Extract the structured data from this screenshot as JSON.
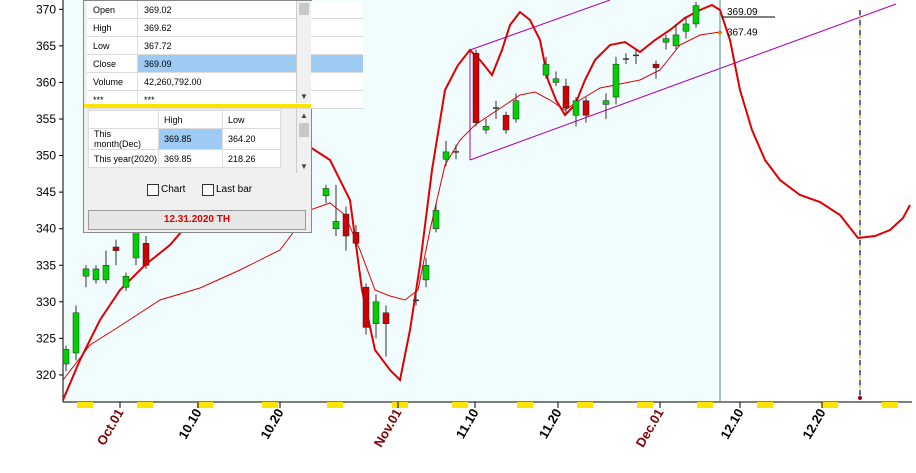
{
  "chart_data": {
    "type": "candlestick",
    "y_ticks": [
      370,
      365,
      360,
      355,
      350,
      345,
      340,
      335,
      330,
      325,
      320
    ],
    "ylim": [
      316.3,
      371
    ],
    "x_ticks": [
      {
        "label": "Oct.01",
        "highlight": true
      },
      {
        "label": "10.10",
        "highlight": false
      },
      {
        "label": "10.20",
        "highlight": false
      },
      {
        "label": "Nov.01",
        "highlight": true
      },
      {
        "label": "11.10",
        "highlight": false
      },
      {
        "label": "11.20",
        "highlight": false
      },
      {
        "label": "Dec.01",
        "highlight": true
      },
      {
        "label": "12.10",
        "highlight": false
      },
      {
        "label": "12.20",
        "highlight": false
      }
    ],
    "candles": [
      {
        "x": 1,
        "open": 321.5,
        "close": 323.5,
        "high": 324,
        "low": 320.5
      },
      {
        "x": 2,
        "open": 323,
        "close": 328.5,
        "high": 329.5,
        "low": 322
      },
      {
        "x": 3,
        "open": 333.5,
        "close": 334.5,
        "high": 335,
        "low": 332
      },
      {
        "x": 4,
        "open": 333,
        "close": 334.5,
        "high": 335,
        "low": 332.5
      },
      {
        "x": 5,
        "open": 333,
        "close": 335,
        "high": 337,
        "low": 332.5
      },
      {
        "x": 6,
        "open": 337.5,
        "close": 337,
        "high": 338.5,
        "low": 335
      },
      {
        "x": 7,
        "open": 332,
        "close": 333.5,
        "high": 334,
        "low": 331.5
      },
      {
        "x": 8,
        "open": 336,
        "close": 340,
        "high": 341,
        "low": 335
      },
      {
        "x": 9,
        "open": 338,
        "close": 335,
        "high": 339,
        "low": 334.5
      },
      {
        "x": 27,
        "open": 344.5,
        "close": 345.5,
        "high": 346,
        "low": 343.5
      },
      {
        "x": 28,
        "open": 340,
        "close": 341,
        "high": 346,
        "low": 339
      },
      {
        "x": 29,
        "open": 342,
        "close": 339,
        "high": 343,
        "low": 337
      },
      {
        "x": 30,
        "open": 339.5,
        "close": 338,
        "high": 340.5,
        "low": 337.5
      },
      {
        "x": 31,
        "open": 332,
        "close": 326.5,
        "high": 332.5,
        "low": 325.5
      },
      {
        "x": 32,
        "open": 327,
        "close": 330,
        "high": 331,
        "low": 325
      },
      {
        "x": 33,
        "open": 328.5,
        "close": 327,
        "high": 329.5,
        "low": 322.5
      },
      {
        "x": 36,
        "open": 330,
        "close": 330.2,
        "high": 331.5,
        "low": 329.5
      },
      {
        "x": 37,
        "open": 333,
        "close": 335,
        "high": 336,
        "low": 332
      },
      {
        "x": 38,
        "open": 340,
        "close": 342.5,
        "high": 343.5,
        "low": 339.5
      },
      {
        "x": 39,
        "open": 349.5,
        "close": 350.5,
        "high": 352,
        "low": 348.5
      },
      {
        "x": 40,
        "open": 350.5,
        "close": 350.5,
        "high": 351.5,
        "low": 349.5
      },
      {
        "x": 42,
        "open": 364,
        "close": 354.5,
        "high": 364.5,
        "low": 354
      },
      {
        "x": 43,
        "open": 353.5,
        "close": 354,
        "high": 355,
        "low": 353
      },
      {
        "x": 44,
        "open": 356.5,
        "close": 356.5,
        "high": 357.5,
        "low": 355
      },
      {
        "x": 45,
        "open": 355.5,
        "close": 353.5,
        "high": 356,
        "low": 353
      },
      {
        "x": 46,
        "open": 355,
        "close": 357.5,
        "high": 358.5,
        "low": 354.5
      },
      {
        "x": 49,
        "open": 361,
        "close": 362.5,
        "high": 363.5,
        "low": 360.5
      },
      {
        "x": 50,
        "open": 360,
        "close": 360.5,
        "high": 361.5,
        "low": 359.5
      },
      {
        "x": 51,
        "open": 359.5,
        "close": 356.5,
        "high": 360.5,
        "low": 355.5
      },
      {
        "x": 52,
        "open": 355.5,
        "close": 357.5,
        "high": 358,
        "low": 354
      },
      {
        "x": 53,
        "open": 357.5,
        "close": 355.5,
        "high": 358,
        "low": 354.5
      },
      {
        "x": 55,
        "open": 357,
        "close": 357.5,
        "high": 358.5,
        "low": 355
      },
      {
        "x": 56,
        "open": 358,
        "close": 362.5,
        "high": 363.5,
        "low": 357
      },
      {
        "x": 57,
        "open": 363,
        "close": 363.2,
        "high": 364,
        "low": 362.5
      },
      {
        "x": 58,
        "open": 363.5,
        "close": 363.7,
        "high": 364.5,
        "low": 362.5
      },
      {
        "x": 60,
        "open": 362.5,
        "close": 362,
        "high": 363,
        "low": 360.5
      },
      {
        "x": 61,
        "open": 365.5,
        "close": 366,
        "high": 366.5,
        "low": 364.5
      },
      {
        "x": 62,
        "open": 365,
        "close": 366.5,
        "high": 368,
        "low": 364.5
      },
      {
        "x": 63,
        "open": 367,
        "close": 368,
        "high": 369,
        "low": 366
      },
      {
        "x": 64,
        "open": 368,
        "close": 370.5,
        "high": 371,
        "low": 367.5
      }
    ],
    "ma_label": "367.49",
    "close_label": "369.09",
    "forecast_label": "12.31.2020 TH"
  },
  "panel": {
    "rows": [
      {
        "label": "Open",
        "value": "369.02",
        "selected": false
      },
      {
        "label": "High",
        "value": "369.62",
        "selected": false
      },
      {
        "label": "Low",
        "value": "367.72",
        "selected": false
      },
      {
        "label": "Close",
        "value": "369.09",
        "selected": true
      },
      {
        "label": "Volume",
        "value": "42,260,792.00",
        "selected": false
      },
      {
        "label": "***",
        "value": "***",
        "selected": false
      }
    ],
    "range_header": {
      "high": "High",
      "low": "Low"
    },
    "range_rows": [
      {
        "label": "This month(Dec)",
        "high": "369.85",
        "low": "364.20"
      },
      {
        "label": "This year(2020)",
        "high": "369.85",
        "low": "218.26"
      }
    ],
    "chart_checkbox": "Chart",
    "lastbar_checkbox": "Last bar",
    "date_label": "12.31.2020 TH"
  },
  "colors": {
    "plot_bg": "#f0fcfd",
    "up": "#00d000",
    "down": "#d00000",
    "ma": "#e00000",
    "channel": "#b000b0",
    "xtick_highlight": "#800000",
    "xtick_normal": "#000000",
    "date_bar_marks": "#ffe400"
  }
}
